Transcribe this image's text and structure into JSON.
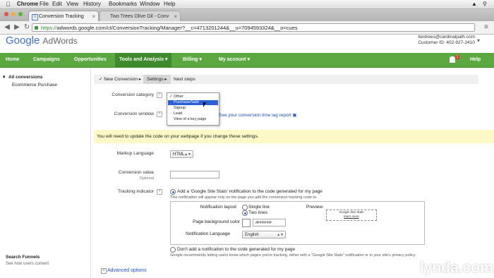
{
  "mac_menu": {
    "app": "Chrome",
    "items": [
      "File",
      "Edit",
      "View",
      "History",
      "Bookmarks",
      "Window",
      "Help"
    ]
  },
  "tabs": [
    {
      "label": "Conversion Tracking",
      "active": true
    },
    {
      "label": "Two Trees Olive Oil - Conv",
      "active": false
    }
  ],
  "url": {
    "scheme": "https://",
    "rest": "adwords.google.com/ct/ConversionTracking/Manager?__c=4713201244&__u=7094593324&__o=cues"
  },
  "header": {
    "logo_google": "Google",
    "logo_adwords": "AdWords",
    "account_email": "twotrees@cardinalpath.com",
    "customer_id": "Customer ID: 402-927-2410"
  },
  "nav": {
    "items": [
      "Home",
      "Campaigns",
      "Opportunities",
      "Tools and Analysis",
      "Billing",
      "My account"
    ],
    "help": "Help",
    "badge": "1"
  },
  "sidebar": {
    "all_conversions": "All conversions",
    "ecommerce": "Ecommerce Purchase",
    "search_funnels": "Search Funnels",
    "search_funnels_sub": "See how users convert"
  },
  "wizard": {
    "steps": [
      "New Conversion",
      "Settings",
      "Next steps"
    ]
  },
  "form": {
    "conversion_category_label": "Conversion category",
    "conversion_window_label": "Conversion window",
    "dropdown_options": [
      "Other",
      "Purchase/Sale",
      "Signup",
      "Lead",
      "View of a key page"
    ],
    "time_lag_link": "See your conversion time lag report",
    "warning": "You will need to update the code on your webpage if you change these settings.",
    "markup_language_label": "Markup Language",
    "markup_language_value": "HTML",
    "conversion_value_label": "Conversion value",
    "optional": "Optional",
    "tracking_indicator_label": "Tracking indicator",
    "option_add": "Add a 'Google Site Stats' notification to the code generated for my page",
    "option_add_note": "This notification will appear only on the page you add the conversion tracking code to.",
    "notification_layout_label": "Notification layout",
    "layout_single": "Single line",
    "layout_two": "Two lines",
    "page_bg_label": "Page background color",
    "page_bg_value": "#FFFFFF",
    "notification_lang_label": "Notification Language",
    "notification_lang_value": "English",
    "preview_label": "Preview:",
    "preview_line1": "Google Site Stats",
    "preview_line2": "learn more",
    "option_dont": "Don't add a notification to the code generated for my page",
    "option_dont_note": "Google recommends letting users know which pages you're tracking, either with a \"Google Site Stats\" notification or in your site's privacy policy.",
    "advanced": "Advanced options"
  },
  "watermark": "lynda.com",
  "colors": {
    "nav_green": "#5ca840",
    "nav_selected": "#3e8a2c",
    "warning_bg": "#fdf9c7",
    "link": "#1a4fc7",
    "highlight": "#2a5fd8"
  }
}
